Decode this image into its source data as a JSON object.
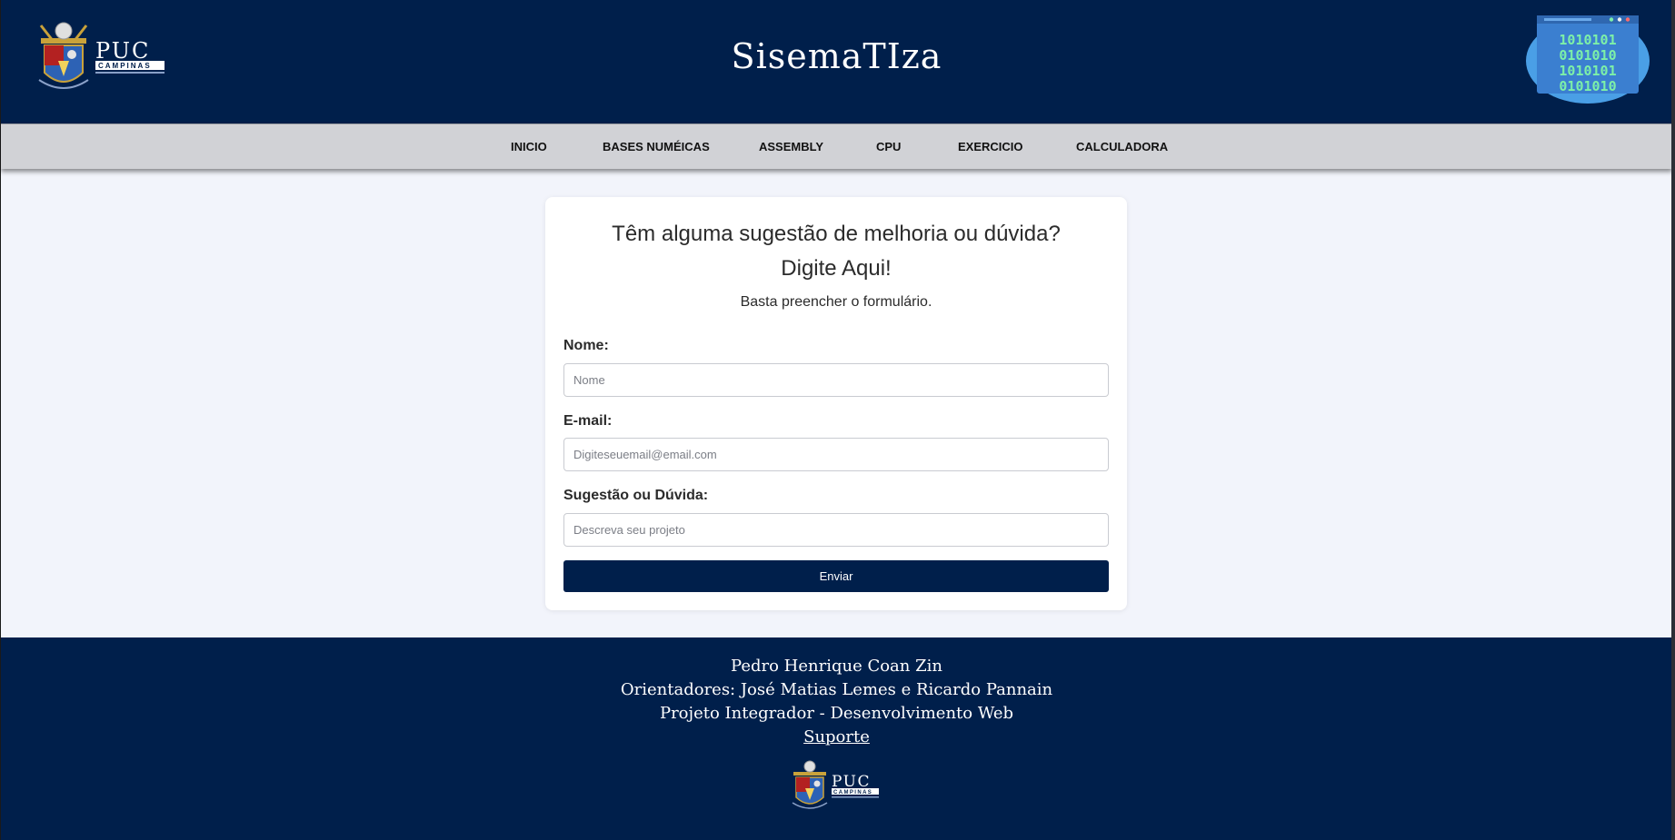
{
  "header": {
    "logo_text": "PUC",
    "logo_subtext": "CAMPINAS",
    "site_title": "SisemaTIza",
    "badge_lines": [
      "1010101",
      "0101010",
      "1010101",
      "0101010"
    ]
  },
  "nav": {
    "items": [
      {
        "label": "INICIO"
      },
      {
        "label": "BASES NUMÉICAS"
      },
      {
        "label": "ASSEMBLY"
      },
      {
        "label": "CPU"
      },
      {
        "label": "EXERCICIO"
      },
      {
        "label": "CALCULADORA"
      }
    ]
  },
  "form": {
    "title_line1": "Têm alguma sugestão de melhoria ou dúvida?",
    "title_line2": "Digite Aqui!",
    "subtitle": "Basta preencher o formulário.",
    "name_label": "Nome:",
    "name_placeholder": "Nome",
    "email_label": "E-mail:",
    "email_placeholder": "Digiteseuemail@email.com",
    "suggestion_label": "Sugestão ou Dúvida:",
    "suggestion_placeholder": "Descreva seu projeto",
    "submit_label": "Enviar"
  },
  "footer": {
    "author": "Pedro Henrique Coan Zin",
    "advisors": "Orientadores: José Matias Lemes e Ricardo Pannain",
    "project": "Projeto Integrador - Desenvolvimento Web",
    "support_link": "Suporte"
  },
  "colors": {
    "primary": "#001f4b",
    "nav_bg": "#d1d2d6",
    "page_bg": "#f2f4fb",
    "badge_bg": "#4a9fe6",
    "badge_text": "#7df0a8"
  }
}
